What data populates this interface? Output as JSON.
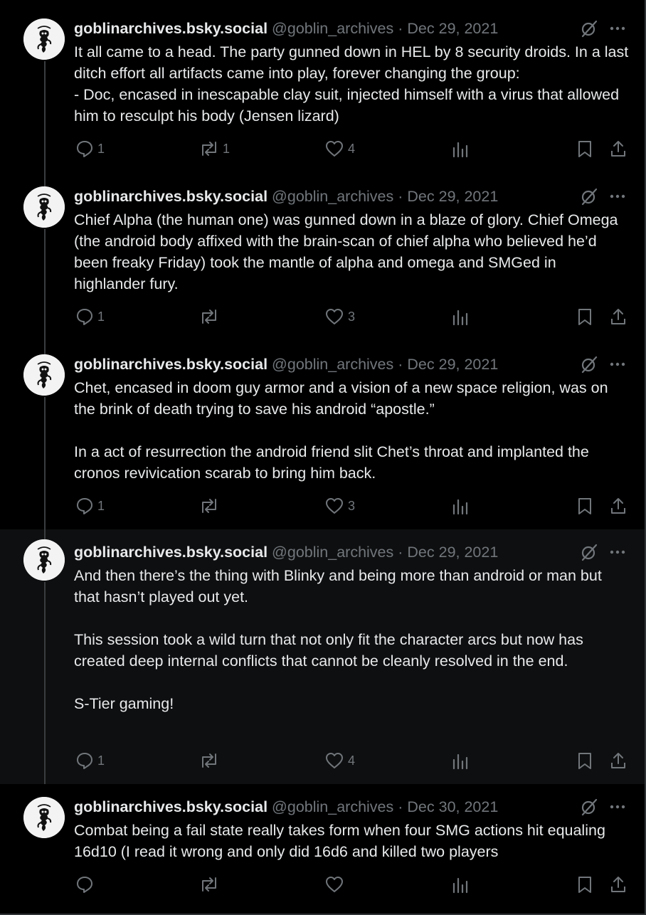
{
  "posts": [
    {
      "display_name": "goblinarchives.bsky.social",
      "handle": "@goblin_archives",
      "date": "Dec 29, 2021",
      "paragraphs": [
        "It all came to a head. The party gunned down in HEL by 8 security droids. In a last ditch effort all artifacts came into play, forever changing the group:",
        "- Doc, encased in inescapable clay suit, injected himself with a virus that allowed him to resculpt his body (Jensen lizard)"
      ],
      "reply_count": "1",
      "repost_count": "1",
      "like_count": "4"
    },
    {
      "display_name": "goblinarchives.bsky.social",
      "handle": "@goblin_archives",
      "date": "Dec 29, 2021",
      "paragraphs": [
        "Chief Alpha (the human one) was gunned down in a blaze of glory. Chief Omega (the android body affixed with the brain-scan of chief alpha who believed he’d been freaky Friday) took the mantle of alpha and omega and SMGed in highlander fury."
      ],
      "reply_count": "1",
      "repost_count": "",
      "like_count": "3"
    },
    {
      "display_name": "goblinarchives.bsky.social",
      "handle": "@goblin_archives",
      "date": "Dec 29, 2021",
      "paragraphs": [
        "Chet, encased in doom guy armor and a vision of a new space religion, was on the brink of death trying to save his android “apostle.”",
        "",
        "In a act of resurrection the android friend slit Chet’s throat and implanted the cronos revivication scarab to bring him back."
      ],
      "reply_count": "1",
      "repost_count": "",
      "like_count": "3"
    },
    {
      "display_name": "goblinarchives.bsky.social",
      "handle": "@goblin_archives",
      "date": "Dec 29, 2021",
      "paragraphs": [
        "And then there’s the thing with Blinky and being more than android or man but that hasn’t played out yet.",
        "",
        "This session took a wild turn that not only fit the character arcs but now has created deep internal conflicts that cannot be cleanly resolved in the end.",
        "",
        "S-Tier gaming!"
      ],
      "reply_count": "1",
      "repost_count": "",
      "like_count": "4"
    },
    {
      "display_name": "goblinarchives.bsky.social",
      "handle": "@goblin_archives",
      "date": "Dec 30, 2021",
      "paragraphs": [
        "Combat being a fail state really takes form when four SMG actions hit equaling 16d10 (I read it wrong and only did 16d6 and killed two players"
      ],
      "reply_count": "",
      "repost_count": "",
      "like_count": ""
    }
  ],
  "separator": "·",
  "icons": {
    "avatar": "goblin-logo-avatar",
    "grok": "grok-icon",
    "more": "more-icon",
    "reply": "reply-icon",
    "repost": "repost-icon",
    "like": "like-icon",
    "views": "views-icon",
    "bookmark": "bookmark-icon",
    "share": "share-icon"
  },
  "colors": {
    "background": "#000000",
    "highlight_background": "#0e0f10",
    "text": "#e7e9ea",
    "muted": "#71767b",
    "thread_line": "#3a3d40"
  }
}
